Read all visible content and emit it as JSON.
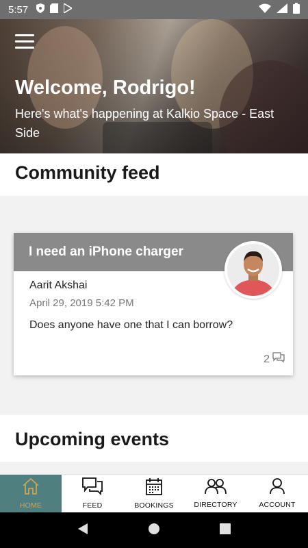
{
  "status_bar": {
    "time": "5:57"
  },
  "hero": {
    "title": "Welcome, Rodrigo!",
    "subtitle": "Here's what's happening at Kalkio Space - East Side"
  },
  "community_feed": {
    "title": "Community feed"
  },
  "post": {
    "title": "I need an iPhone charger",
    "author": "Aarit Akshai",
    "date": "April 29, 2019 5:42 PM",
    "body": "Does anyone have one that I can borrow?",
    "comment_count": "2"
  },
  "upcoming_events": {
    "title": "Upcoming events"
  },
  "bottom_nav": {
    "items": [
      {
        "label": "HOME",
        "icon": "home-icon",
        "active": true
      },
      {
        "label": "FEED",
        "icon": "feed-icon",
        "active": false
      },
      {
        "label": "BOOKINGS",
        "icon": "calendar-icon",
        "active": false
      },
      {
        "label": "DIRECTORY",
        "icon": "people-icon",
        "active": false
      },
      {
        "label": "ACCOUNT",
        "icon": "person-icon",
        "active": false
      }
    ]
  },
  "colors": {
    "active_tab_bg": "#4f7f7e",
    "active_tab_fg": "#c7a75c",
    "card_header": "#8a8a8a"
  }
}
